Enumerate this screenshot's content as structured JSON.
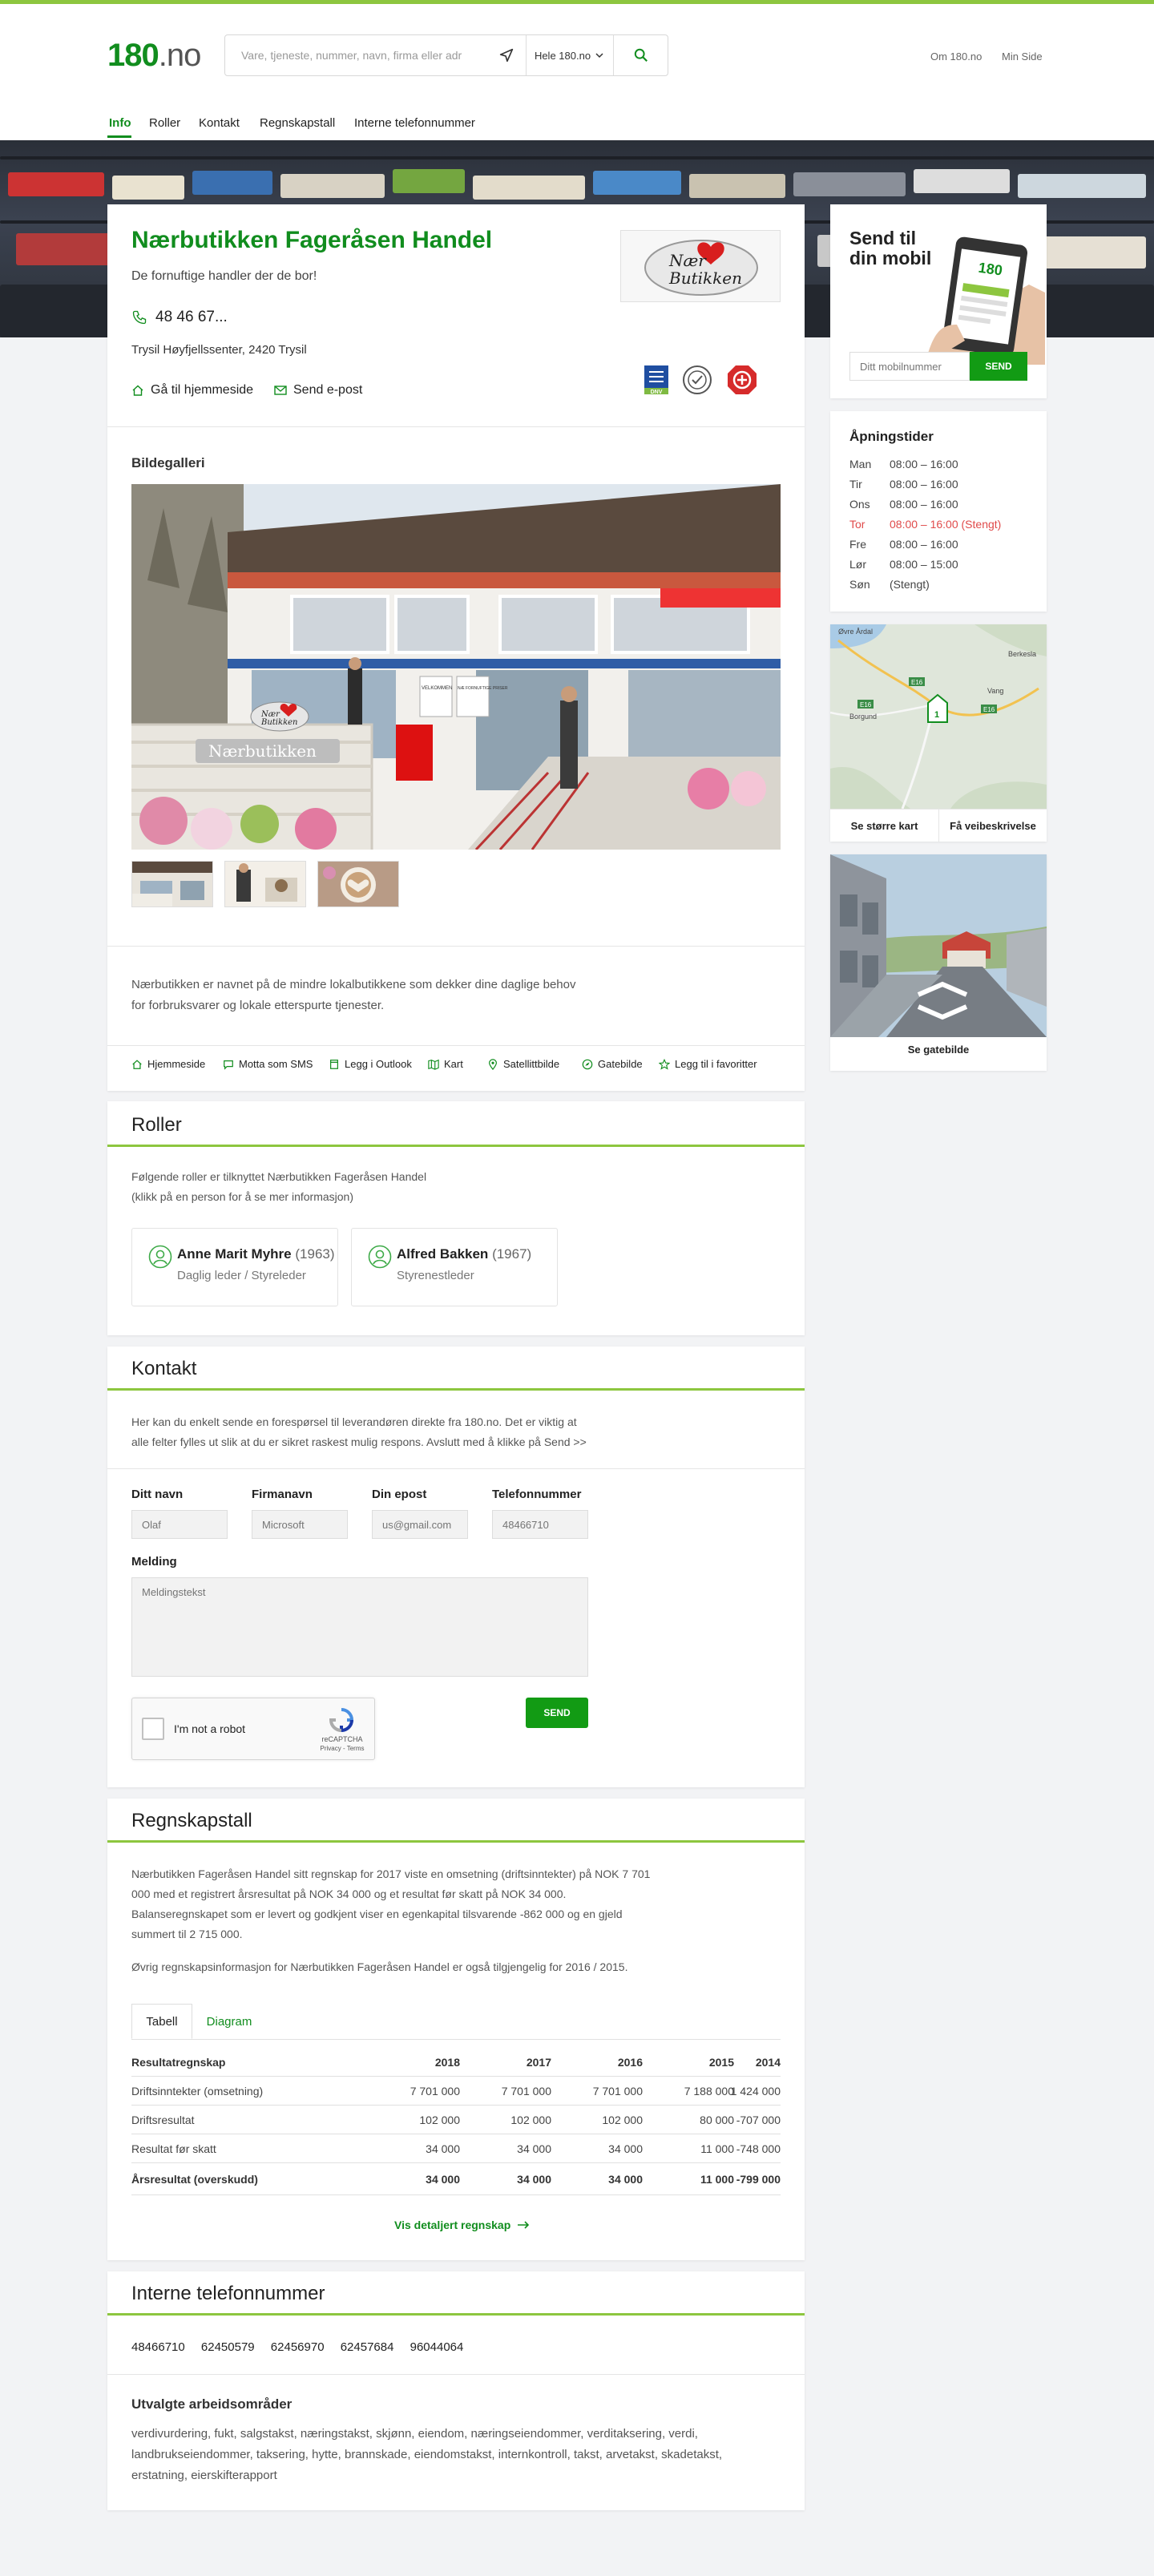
{
  "header": {
    "logo_main": "180",
    "logo_suffix": ".no",
    "search_placeholder": "Vare, tjeneste, nummer, navn, firma eller adr",
    "region": "Hele 180.no",
    "links": [
      "Om 180.no",
      "Min Side"
    ]
  },
  "nav": {
    "items": [
      "Info",
      "Roller",
      "Kontakt",
      "Regnskapstall",
      "Interne telefonnummer"
    ],
    "active": "Info"
  },
  "company": {
    "name": "Nærbutikken Fageråsen Handel",
    "tagline": "De fornuftige handler der de bor!",
    "phone": "48 46 67...",
    "address": "Trysil Høyfjellssenter, 2420 Trysil",
    "homepage_link": "Gå til hjemmeside",
    "email_link": "Send e-post",
    "logo_text_1": "Nær",
    "logo_text_2": "Butikken",
    "cert_label": "DNV"
  },
  "gallery": {
    "title": "Bildegalleri",
    "sign_text": "Nærbutikken",
    "sign_logo_1": "Nær",
    "sign_logo_2": "Butikken",
    "poster_1": "VELKOMMEN",
    "poster_2": "NÆ FORNUFTIGE PRISER"
  },
  "description": "Nærbutikken er navnet på de mindre lokalbutikkene som dekker dine daglige behov for forbruksvarer og lokale etterspurte tjenester.",
  "actions": [
    "Hjemmeside",
    "Motta som SMS",
    "Legg i Outlook",
    "Kart",
    "Satellittbilde",
    "Gatebilde",
    "Legg til i favoritter"
  ],
  "roles": {
    "title": "Roller",
    "intro_1": "Følgende roller er tilknyttet Nærbutikken Fageråsen Handel",
    "intro_2": "(klikk på en person for å se mer informasjon)",
    "people": [
      {
        "name": "Anne Marit Myhre",
        "year": "(1963)",
        "role": "Daglig leder / Styreleder"
      },
      {
        "name": "Alfred Bakken",
        "year": "(1967)",
        "role": "Styrenestleder"
      }
    ]
  },
  "contact": {
    "title": "Kontakt",
    "intro_1": "Her kan du enkelt sende en forespørsel til leverandøren direkte fra 180.no. Det er viktig at",
    "intro_2": "alle felter fylles ut slik at du er sikret raskest mulig respons. Avslutt med å klikke på Send >>",
    "fields": [
      {
        "label": "Ditt navn",
        "placeholder": "Olaf"
      },
      {
        "label": "Firmanavn",
        "placeholder": "Microsoft"
      },
      {
        "label": "Din epost",
        "placeholder": "us@gmail.com"
      },
      {
        "label": "Telefonnummer",
        "placeholder": "48466710"
      }
    ],
    "message_label": "Melding",
    "message_placeholder": "Meldingstekst",
    "captcha_label": "I'm not a robot",
    "captcha_brand": "reCAPTCHA",
    "captcha_terms": "Privacy - Terms",
    "send": "SEND"
  },
  "accounts": {
    "title": "Regnskapstall",
    "para_1": "Nærbutikken Fageråsen Handel sitt regnskap for 2017 viste en omsetning (driftsinntekter) på NOK 7 701 000 med et registrert årsresultat på NOK 34 000 og et resultat før skatt på NOK 34 000. Balanseregnskapet som er levert og godkjent viser en egenkapital tilsvarende -862 000 og en gjeld summert til 2 715 000.",
    "para_2": "Øvrig regnskapsinformasjon for Nærbutikken Fageråsen Handel er også tilgjengelig for 2016 / 2015.",
    "tabs": [
      "Tabell",
      "Diagram"
    ],
    "table": {
      "header": "Resultatregnskap",
      "years": [
        "2018",
        "2017",
        "2016",
        "2015",
        "2014"
      ],
      "rows": [
        {
          "label": "Driftsinntekter (omsetning)",
          "values": [
            "7 701 000",
            "7 701 000",
            "7 701 000",
            "7 188 000",
            "1 424 000"
          ]
        },
        {
          "label": "Driftsresultat",
          "values": [
            "102 000",
            "102 000",
            "102 000",
            "80 000",
            "-707 000"
          ]
        },
        {
          "label": "Resultat før skatt",
          "values": [
            "34 000",
            "34 000",
            "34 000",
            "11 000",
            "-748 000"
          ]
        },
        {
          "label": "Årsresultat (overskudd)",
          "values": [
            "34 000",
            "34 000",
            "34 000",
            "11 000",
            "-799 000"
          ]
        }
      ]
    },
    "more_link": "Vis detaljert regnskap"
  },
  "internal": {
    "title": "Interne telefonnummer",
    "numbers": "48466710 62450579 62456970 62457684 96044064",
    "areas_title": "Utvalgte arbeidsområder",
    "areas": "verdivurdering, fukt, salgstakst, næringstakst, skjønn, eiendom, næringseiendommer, verditaksering, verdi, landbrukseiendommer, taksering, hytte, brannskade, eiendomstakst, internkontroll, takst, arvetakst, skadetakst, erstatning, eierskifterapport"
  },
  "sidebar": {
    "mobile": {
      "title": "Send til din mobil",
      "placeholder": "Ditt mobilnummer",
      "send": "SEND",
      "phone_screen": "180"
    },
    "hours": {
      "title": "Åpningstider",
      "rows": [
        {
          "day": "Man",
          "time": "08:00 – 16:00"
        },
        {
          "day": "Tir",
          "time": "08:00 – 16:00"
        },
        {
          "day": "Ons",
          "time": "08:00 – 16:00"
        },
        {
          "day": "Tor",
          "time": "08:00 – 16:00 (Stengt)"
        },
        {
          "day": "Fre",
          "time": "08:00 – 16:00"
        },
        {
          "day": "Lør",
          "time": "08:00 – 15:00"
        },
        {
          "day": "Søn",
          "time": "(Stengt)"
        }
      ],
      "today": "Tor"
    },
    "map": {
      "bigger": "Se større kart",
      "directions": "Få veibeskrivelse",
      "labels": [
        "Øvre Årdal",
        "Berkesla",
        "Borgund",
        "Vang"
      ],
      "roads": [
        "E16",
        "E16",
        "E16"
      ],
      "marker": "1"
    },
    "street": {
      "label": "Se gatebilde"
    }
  },
  "colors": {
    "brand_green": "#118d1e",
    "accent_lime": "#8dc63f",
    "button_green": "#129b14",
    "closed_red": "#e04a4a"
  }
}
